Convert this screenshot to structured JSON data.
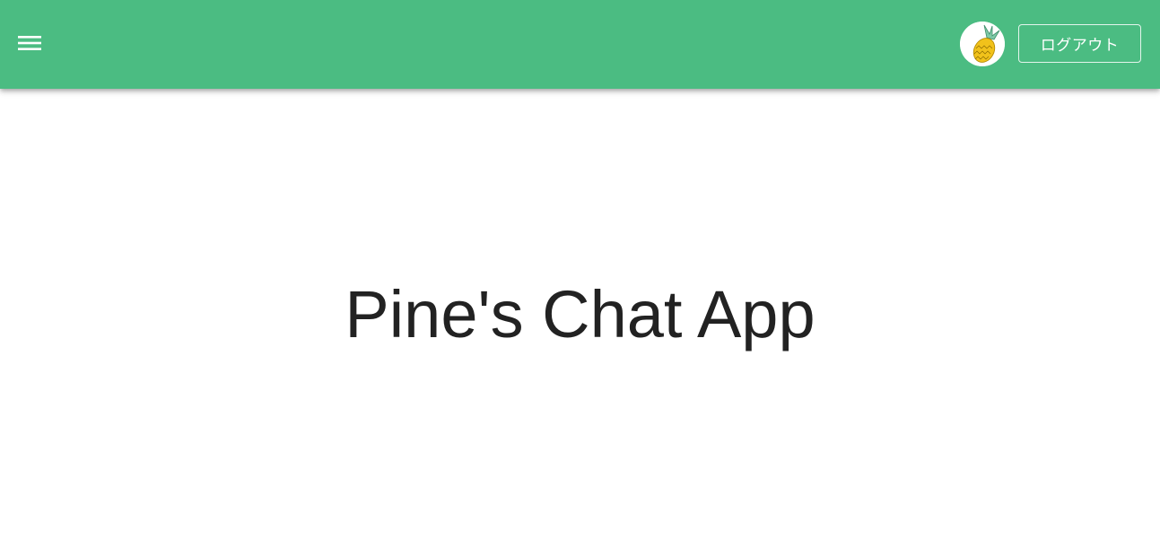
{
  "header": {
    "background_color": "#4bbc82",
    "menu_icon": "menu-icon",
    "avatar_icon": "pineapple-avatar",
    "logout_label": "ログアウト"
  },
  "main": {
    "title": "Pine's Chat App"
  }
}
